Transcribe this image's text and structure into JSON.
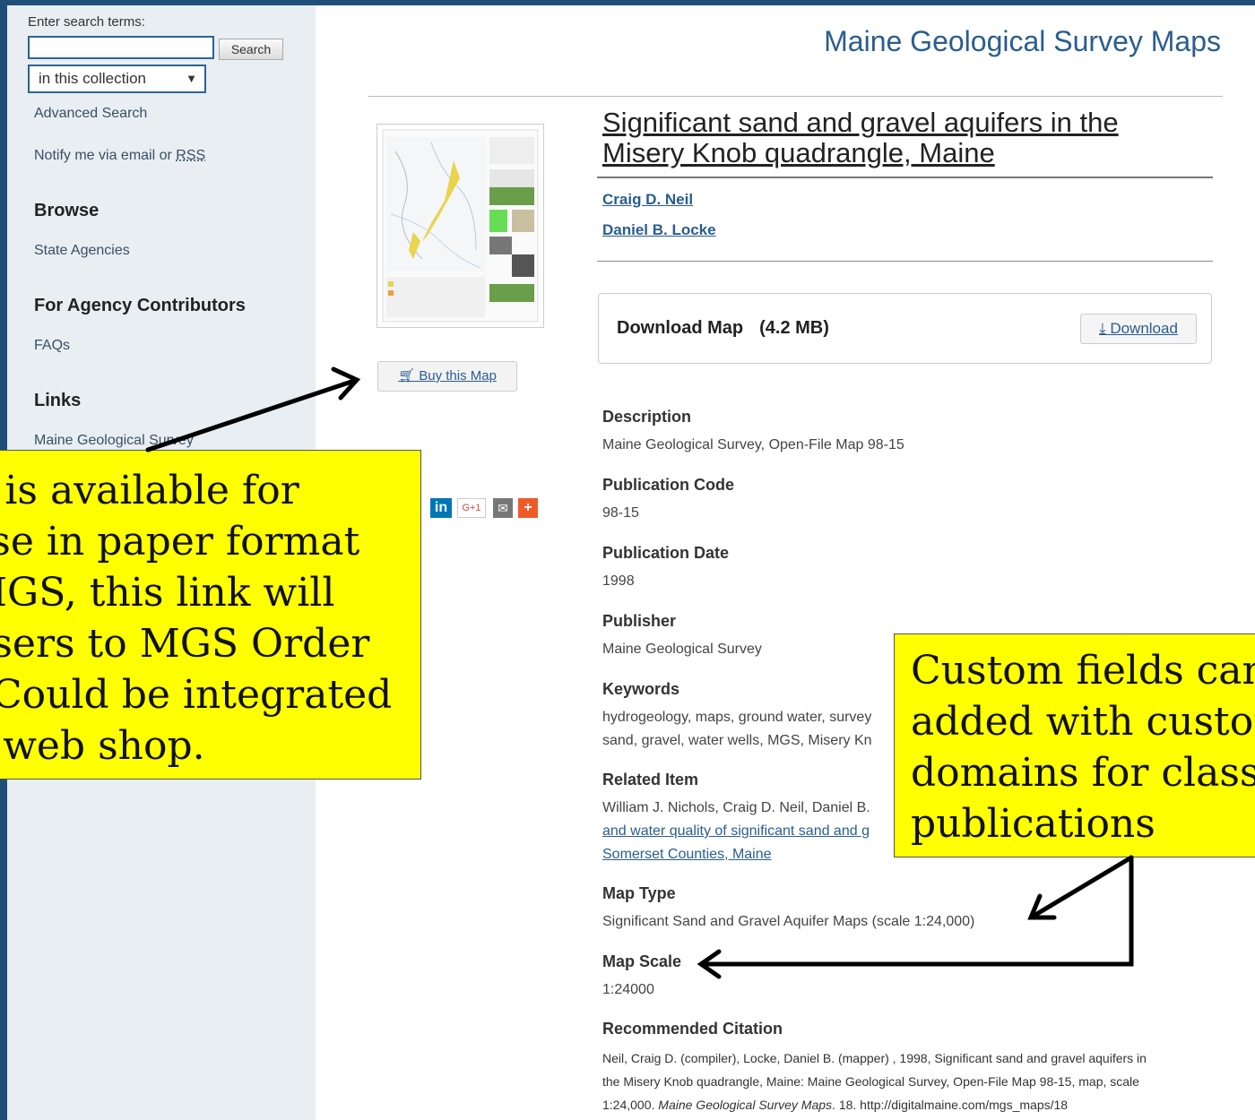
{
  "sidebar": {
    "search_label": "Enter search terms:",
    "search_value": "",
    "search_button": "Search",
    "scope_select": "in this collection",
    "advanced_search": "Advanced Search",
    "notify_prefix": "Notify me via email or ",
    "notify_rss": "RSS",
    "browse_heading": "Browse",
    "browse_item": "State Agencies",
    "contrib_heading": "For Agency Contributors",
    "contrib_item": "FAQs",
    "links_heading": "Links",
    "links_item": "Maine Geological Survey"
  },
  "header": {
    "title": "Maine Geological Survey Maps"
  },
  "item": {
    "title_line1": "Significant sand and gravel aquifers in the",
    "title_line2": "Misery Knob quadrangle, Maine",
    "authors": [
      "Craig D. Neil",
      "Daniel B. Locke"
    ],
    "buy_button": "Buy this Map",
    "download_label": "Download Map",
    "download_size": "(4.2 MB)",
    "download_button": "Download"
  },
  "fields": {
    "description_label": "Description",
    "description_value": "Maine Geological Survey, Open-File Map 98-15",
    "pubcode_label": "Publication Code",
    "pubcode_value": "98-15",
    "pubdate_label": "Publication Date",
    "pubdate_value": "1998",
    "publisher_label": "Publisher",
    "publisher_value": "Maine Geological Survey",
    "keywords_label": "Keywords",
    "keywords_line1": "hydrogeology, maps, ground water, survey",
    "keywords_line2": "sand, gravel, water wells, MGS, Misery Kn",
    "related_label": "Related Item",
    "related_line1": "William J. Nichols, Craig D. Neil, Daniel B.",
    "related_line2": "and water quality of significant sand and g",
    "related_line3": "Somerset Counties, Maine",
    "maptype_label": "Map Type",
    "maptype_value": "Significant Sand and Gravel Aquifer Maps (scale 1:24,000)",
    "mapscale_label": "Map Scale",
    "mapscale_value": "1:24000",
    "citation_label": "Recommended Citation",
    "citation_line1": "Neil, Craig D. (compiler), Locke, Daniel B. (mapper) , 1998, Significant sand and gravel aquifers in",
    "citation_line2": "the Misery Knob quadrangle, Maine: Maine Geological Survey, Open-File Map 98-15, map, scale",
    "citation_line3_prefix": "1:24,000. ",
    "citation_line3_italic": "Maine Geological Survey Maps",
    "citation_line3_suffix": ". 18. http://digitalmaine.com/mgs_maps/18"
  },
  "social": {
    "linkedin": "in",
    "gplus": "G+1",
    "email": "✉",
    "add": "+"
  },
  "callouts": {
    "left_lines": [
      "n is available for",
      "ase in paper format",
      "MGS, this link will",
      "users to MGS Order",
      ".  Could be integrated",
      "a web shop."
    ],
    "right_lines": [
      "Custom fields can b",
      "added with custom",
      "domains for classif",
      "publications"
    ]
  },
  "colors": {
    "sidebar_bg": "#e8eef2",
    "link": "#2a5d8f",
    "callout": "#ffff00",
    "accent": "#1f4e79"
  }
}
